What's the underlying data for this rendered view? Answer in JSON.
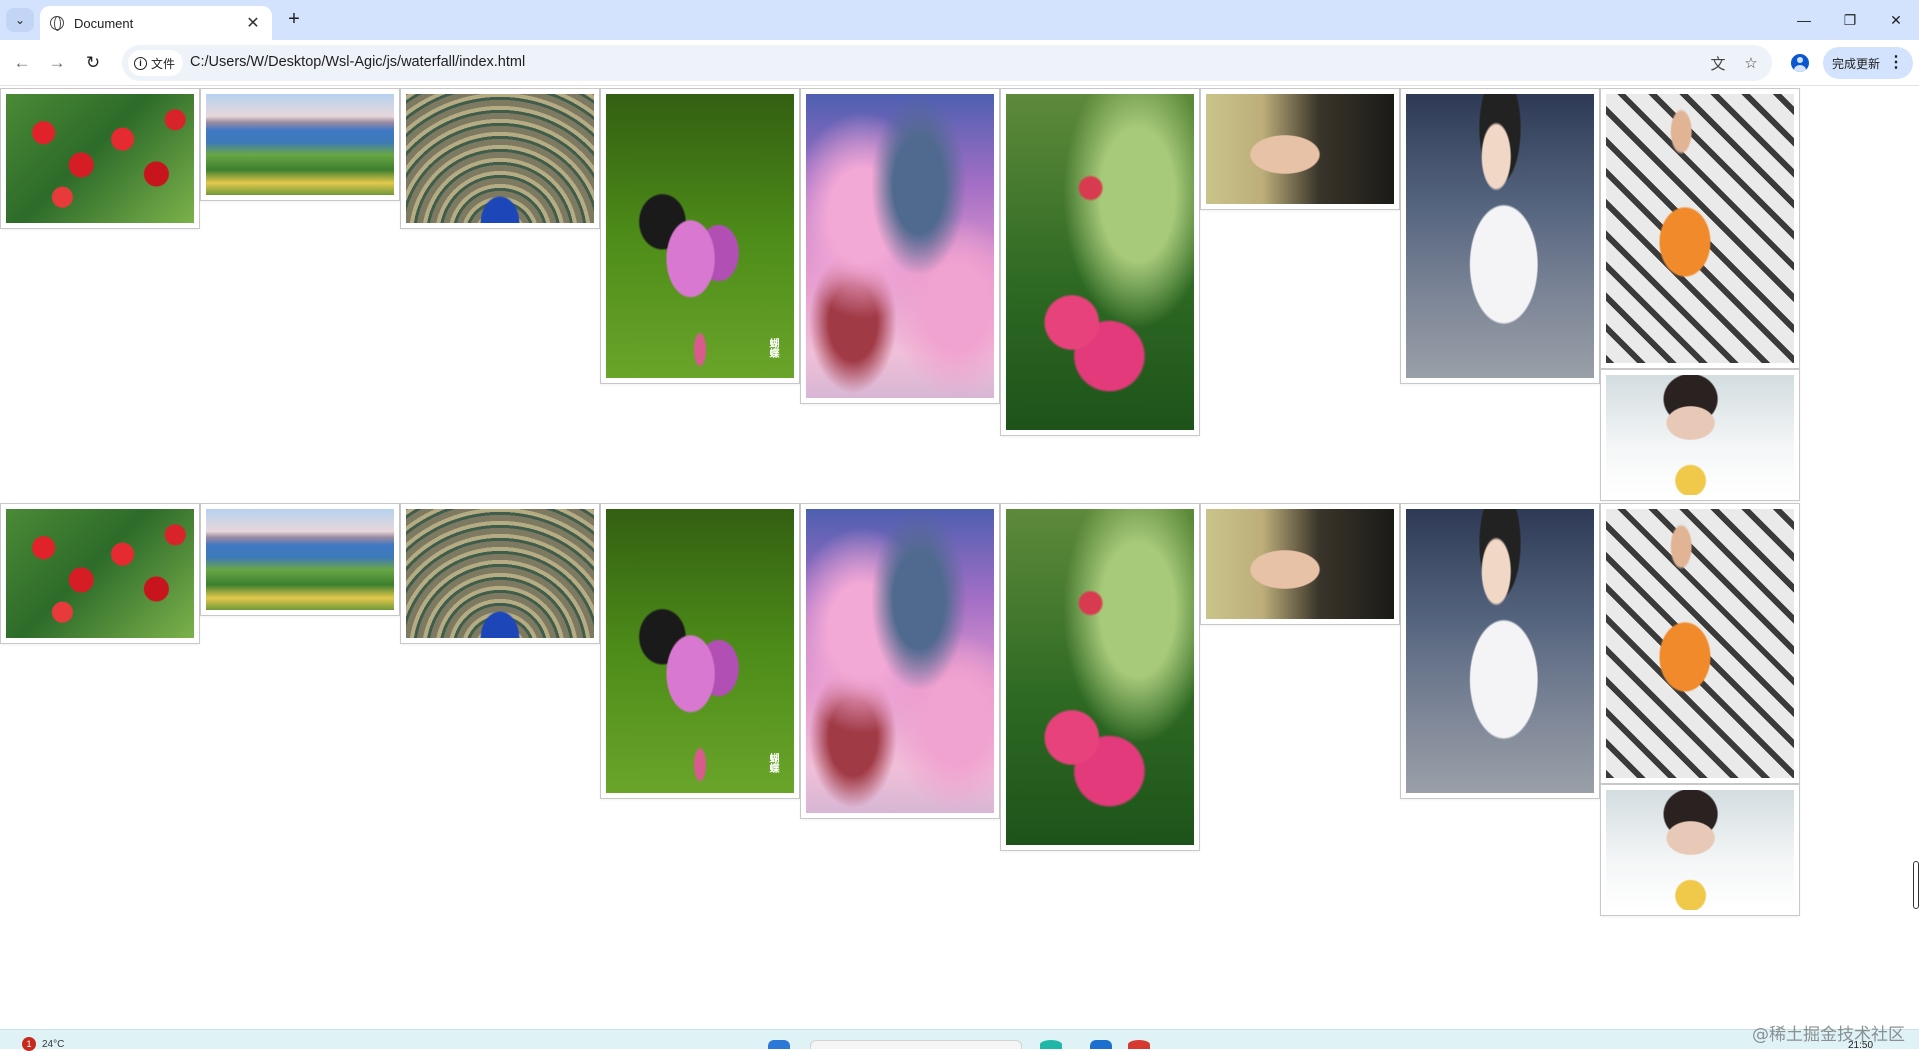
{
  "browser": {
    "tab_search_icon": "chevron-down-icon",
    "tab": {
      "title": "Document",
      "icon": "globe-icon",
      "close": "✕"
    },
    "new_tab": "+",
    "window_controls": {
      "minimize": "—",
      "restore": "❐",
      "close": "✕"
    }
  },
  "toolbar": {
    "back": "←",
    "forward": "→",
    "reload": "↻",
    "security_chip": "文件",
    "url": "C:/Users/W/Desktop/Wsl-Agic/js/waterfall/index.html",
    "translate_icon": "translate-icon",
    "bookmark_icon": "star-icon",
    "profile_icon": "profile-icon",
    "update_label": "完成更新"
  },
  "gallery": {
    "groups": [
      {
        "images": [
          "cherries",
          "lake-landscape",
          "peacock",
          "butterfly-cosmos",
          "fantasy-village",
          "pink-peony",
          "woman-portrait",
          "girl-white-shirt",
          "woman-orange-dress",
          "girl-on-bed"
        ]
      },
      {
        "images": [
          "cherries",
          "lake-landscape",
          "peacock",
          "butterfly-cosmos",
          "fantasy-village",
          "pink-peony",
          "woman-portrait",
          "girl-white-shirt",
          "woman-orange-dress",
          "girl-on-bed"
        ]
      }
    ],
    "butterfly_caption": "蝴蝶"
  },
  "taskbar": {
    "weather_temp": "24°C",
    "notification_count": "1",
    "clock": "21:50"
  },
  "watermark": "@稀土掘金技术社区"
}
